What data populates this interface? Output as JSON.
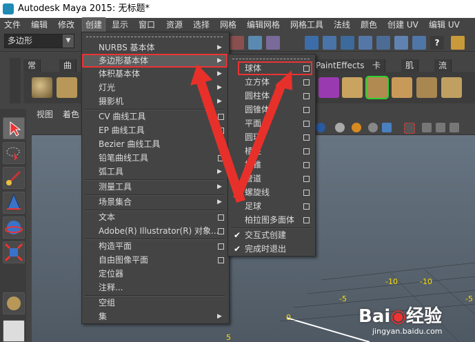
{
  "app": {
    "title": "Autodesk Maya 2015: 无标题*"
  },
  "menubar": [
    {
      "label": "文件"
    },
    {
      "label": "编辑"
    },
    {
      "label": "修改"
    },
    {
      "label": "创建",
      "active": true
    },
    {
      "label": "显示"
    },
    {
      "label": "窗口"
    },
    {
      "label": "资源"
    },
    {
      "label": "选择"
    },
    {
      "label": "网格"
    },
    {
      "label": "编辑网格"
    },
    {
      "label": "网格工具"
    },
    {
      "label": "法线"
    },
    {
      "label": "颜色"
    },
    {
      "label": "创建 UV"
    },
    {
      "label": "编辑 UV"
    }
  ],
  "mode_selector": {
    "value": "多边形"
  },
  "shelf_tabs": [
    {
      "label": "常规"
    },
    {
      "label": "曲线"
    },
    {
      "label": "PaintEffects"
    },
    {
      "label": "卡通"
    },
    {
      "label": "肌肉"
    },
    {
      "label": "流体"
    }
  ],
  "viewport_menu": [
    {
      "label": "视图"
    },
    {
      "label": "着色"
    }
  ],
  "create_menu": {
    "items": [
      {
        "label": "NURBS 基本体",
        "arrow": true
      },
      {
        "label": "多边形基本体",
        "arrow": true,
        "highlight": true
      },
      {
        "label": "体积基本体",
        "arrow": true
      },
      {
        "label": "灯光",
        "arrow": true
      },
      {
        "label": "摄影机",
        "arrow": true
      },
      {
        "label": "CV 曲线工具",
        "option": true
      },
      {
        "label": "EP 曲线工具",
        "option": true
      },
      {
        "label": "Bezier 曲线工具",
        "option": true
      },
      {
        "label": "铅笔曲线工具",
        "option": true
      },
      {
        "label": "弧工具",
        "arrow": true
      },
      {
        "label": "测量工具",
        "arrow": true
      },
      {
        "label": "场景集合",
        "arrow": true
      },
      {
        "label": "文本",
        "option": true
      },
      {
        "label": "Adobe(R) Illustrator(R) 对象...",
        "option": true
      },
      {
        "label": "构造平面",
        "option": true
      },
      {
        "label": "自由图像平面",
        "option": true
      },
      {
        "label": "定位器"
      },
      {
        "label": "注释..."
      },
      {
        "label": "空组"
      },
      {
        "label": "集",
        "arrow": true
      }
    ]
  },
  "poly_submenu": {
    "items": [
      {
        "label": "球体",
        "option": true,
        "highlight": true
      },
      {
        "label": "立方体",
        "option": true
      },
      {
        "label": "圆柱体",
        "option": true
      },
      {
        "label": "圆锥体",
        "option": true
      },
      {
        "label": "平面",
        "option": true
      },
      {
        "label": "圆环",
        "option": true
      },
      {
        "label": "棱柱",
        "option": true
      },
      {
        "label": "棱锥",
        "option": true
      },
      {
        "label": "管道",
        "option": true
      },
      {
        "label": "螺旋线",
        "option": true
      },
      {
        "label": "足球",
        "option": true
      },
      {
        "label": "柏拉图多面体",
        "option": true
      }
    ],
    "checks": [
      {
        "label": "交互式创建",
        "checked": true
      },
      {
        "label": "完成时退出",
        "checked": true
      }
    ]
  },
  "grid_labels": [
    {
      "label": "-10"
    },
    {
      "label": "-10"
    },
    {
      "label": "-5"
    },
    {
      "label": "-5"
    },
    {
      "label": "0"
    },
    {
      "label": "5"
    }
  ],
  "watermark": {
    "brand": "Bai",
    "brand2": "经验",
    "url": "jingyan.baidu.com"
  },
  "colors": {
    "annotation_red": "#e8302a",
    "menu_bg": "#444444",
    "highlight": "#5d5d5d",
    "grid_label": "#ffdd00"
  }
}
